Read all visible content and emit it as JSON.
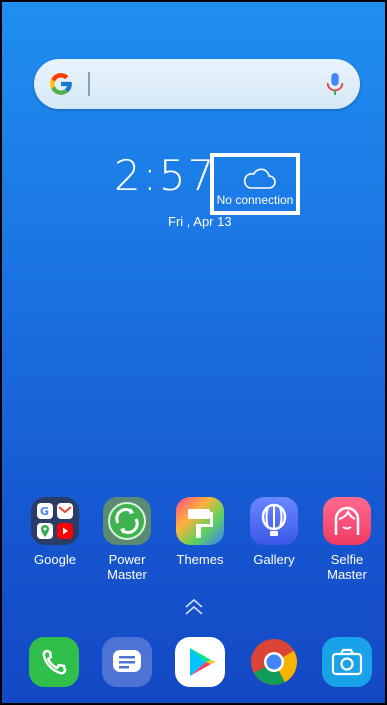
{
  "search": {
    "g_icon": "google-g-icon",
    "mic_icon": "microphone-icon"
  },
  "clock": {
    "time": "2:57",
    "date": "Fri , Apr 13"
  },
  "weather": {
    "icon": "cloud-icon",
    "status": "No connection"
  },
  "apps": [
    {
      "name": "google-folder",
      "label": "Google",
      "icon": "google-folder-icon"
    },
    {
      "name": "power-master",
      "label_lines": [
        "Power",
        "Master"
      ],
      "icon": "power-master-icon"
    },
    {
      "name": "themes",
      "label": "Themes",
      "icon": "themes-icon"
    },
    {
      "name": "gallery",
      "label": "Gallery",
      "icon": "gallery-icon"
    },
    {
      "name": "selfie-master",
      "label_lines": [
        "Selfie",
        "Master"
      ],
      "icon": "selfie-master-icon"
    }
  ],
  "app_drawer_icon": "chevron-up-double-icon",
  "dock": [
    {
      "name": "phone",
      "icon": "phone-icon"
    },
    {
      "name": "messages",
      "icon": "messages-icon"
    },
    {
      "name": "play-store",
      "icon": "play-store-icon"
    },
    {
      "name": "chrome",
      "icon": "chrome-icon"
    },
    {
      "name": "camera",
      "icon": "camera-icon"
    }
  ],
  "colors": {
    "wallpaper_top": "#1f8ff0",
    "wallpaper_bottom": "#1448c4",
    "phone_green": "#2fbf4a",
    "messages_blue": "#4d73d6",
    "camera_blue": "#1aa2e8"
  }
}
